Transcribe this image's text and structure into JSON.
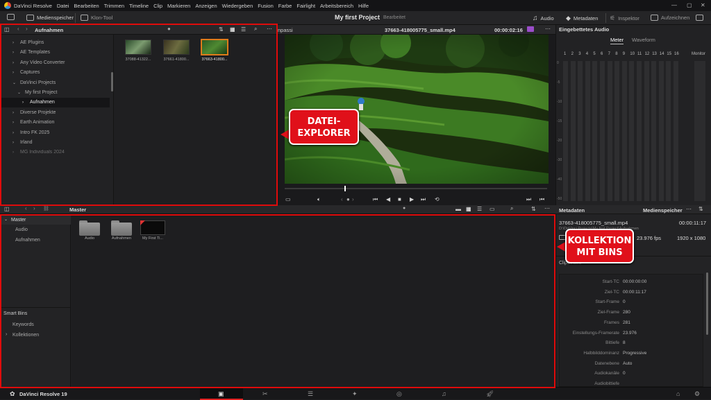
{
  "menubar": {
    "items": [
      "DaVinci Resolve",
      "Datei",
      "Bearbeiten",
      "Trimmen",
      "Timeline",
      "Clip",
      "Markieren",
      "Anzeigen",
      "Wiedergeben",
      "Fusion",
      "Farbe",
      "Fairlight",
      "Arbeitsbereich",
      "Hilfe"
    ]
  },
  "toolbar": {
    "media_pool": "Medienspeicher",
    "clone_tool": "Klon-Tool",
    "project_title": "My first Project",
    "project_status": "Bearbeitet",
    "audio": "Audio",
    "metadata": "Metadaten",
    "inspector": "Inspektor",
    "record": "Aufzeichnen"
  },
  "explorer": {
    "path": "Aufnahmen",
    "tree": [
      {
        "label": "AE Plugins",
        "chev": "›",
        "indent": 0
      },
      {
        "label": "AE Templates",
        "chev": "›",
        "indent": 0
      },
      {
        "label": "Any Video Converter",
        "chev": "›",
        "indent": 0
      },
      {
        "label": "Captures",
        "chev": "›",
        "indent": 0
      },
      {
        "label": "DaVinci Projects",
        "chev": "⌄",
        "indent": 0
      },
      {
        "label": "My first Project",
        "chev": "⌄",
        "indent": 1
      },
      {
        "label": "Aufnahmen",
        "chev": "›",
        "indent": 2
      },
      {
        "label": "Diverse Projekte",
        "chev": "›",
        "indent": 0
      },
      {
        "label": "Earth Animation",
        "chev": "›",
        "indent": 0
      },
      {
        "label": "Intro FK 2025",
        "chev": "›",
        "indent": 0
      },
      {
        "label": "Irland",
        "chev": "›",
        "indent": 0
      },
      {
        "label": "MG Individuals 2024",
        "chev": "›",
        "indent": 0
      }
    ],
    "thumbs": [
      "37088-41322...",
      "37661-41800...",
      "37663-41800..."
    ]
  },
  "viewer": {
    "fit": "npassi",
    "filename": "37663-418005775_small.mp4",
    "timecode": "00:00:02:16"
  },
  "audio": {
    "title": "Eingebettetes Audio",
    "tab_meter": "Meter",
    "tab_waveform": "Waveform",
    "channels": [
      "1",
      "2",
      "3",
      "4",
      "5",
      "6",
      "7",
      "8",
      "9",
      "10",
      "11",
      "12",
      "13",
      "14",
      "15",
      "16"
    ],
    "monitor": "Monitor",
    "scale": [
      "0",
      "-5",
      "-10",
      "-15",
      "-20",
      "-30",
      "-40",
      "-50"
    ]
  },
  "bins": {
    "master": "Master",
    "tree": [
      "Master",
      "Audio",
      "Aufnahmen"
    ],
    "smart_bins": "Smart Bins",
    "smart_items": [
      "Keywords",
      "Kollektionen"
    ],
    "items": [
      "Audio",
      "Aufnahmen",
      "My First Ti..."
    ]
  },
  "metadata": {
    "tab_metadata": "Metadaten",
    "tab_media": "Medienspeicher",
    "clip_name": "37663-418005775_small.mp4",
    "clip_path": "D:\\DaVinci Projects\\My first Project\\Aufnahmen",
    "duration": "00:00:11:17",
    "fps": "23.976 fps",
    "resolution": "1920 x 1080",
    "section": "Clipdetails",
    "rows": [
      {
        "k": "Start-TC",
        "v": "00:00:00:00"
      },
      {
        "k": "Ziel-TC",
        "v": "00:00:11:17"
      },
      {
        "k": "Start-Frame",
        "v": "0"
      },
      {
        "k": "Ziel-Frame",
        "v": "280"
      },
      {
        "k": "Frames",
        "v": "281"
      },
      {
        "k": "Einstellungs-Framerate",
        "v": "23.976"
      },
      {
        "k": "Bittiefe",
        "v": "8"
      },
      {
        "k": "Halbbilddominanz",
        "v": "Progressive"
      },
      {
        "k": "Datenebene",
        "v": "Auto"
      },
      {
        "k": "Audiokanäle",
        "v": "0"
      },
      {
        "k": "Audiobittiefe",
        "v": ""
      }
    ]
  },
  "annotations": {
    "explorer_line1": "DATEI-",
    "explorer_line2": "EXPLORER",
    "bins_line1": "KOLLEKTION",
    "bins_line2": "MIT BINS"
  },
  "statusbar": {
    "version": "DaVinci Resolve 19"
  }
}
